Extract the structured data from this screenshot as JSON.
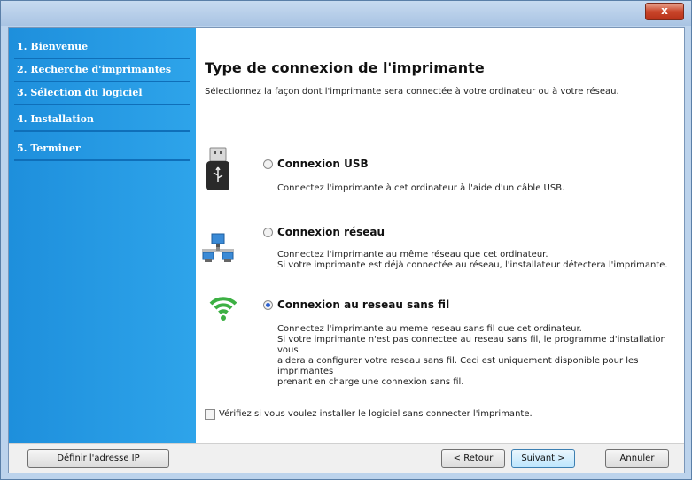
{
  "window": {
    "close_label": "x"
  },
  "sidebar": {
    "items": [
      {
        "label": "1. Bienvenue"
      },
      {
        "label": "2. Recherche d'imprimantes"
      },
      {
        "label": "3. Sélection du logiciel"
      },
      {
        "label": "4. Installation"
      },
      {
        "label": "5. Terminer"
      }
    ]
  },
  "main": {
    "title": "Type de connexion de l'imprimante",
    "subtitle": "Sélectionnez la façon dont l'imprimante sera connectée à votre ordinateur ou à votre réseau.",
    "options": [
      {
        "label": "Connexion USB",
        "checked": false,
        "icon": "usb-drive-icon",
        "desc": [
          "Connectez l'imprimante à cet ordinateur à l'aide d'un câble USB."
        ]
      },
      {
        "label": "Connexion réseau",
        "checked": false,
        "icon": "network-icon",
        "desc": [
          "Connectez l'imprimante au même réseau que cet ordinateur.",
          "Si votre imprimante est déjà connectée au réseau, l'installateur détectera l'imprimante."
        ]
      },
      {
        "label": "Connexion au reseau sans fil",
        "checked": true,
        "icon": "wifi-icon",
        "desc": [
          "Connectez l'imprimante au meme reseau sans fil que cet ordinateur.",
          "Si votre imprimante n'est pas connectee au reseau sans fil, le programme d'installation vous",
          "aidera a configurer votre reseau sans fil. Ceci est uniquement disponible pour les imprimantes",
          "prenant en charge une connexion sans fil."
        ]
      }
    ],
    "checkbox_label": "Vérifiez si vous voulez installer le logiciel sans connecter l'imprimante.",
    "checkbox_checked": false
  },
  "footer": {
    "ip_button": "Définir l'adresse IP",
    "back_button": "< Retour",
    "next_button": "Suivant >",
    "cancel_button": "Annuler"
  },
  "colors": {
    "sidebar": "#2a9be6",
    "titlebar": "#b9d1ec",
    "close": "#c9452a",
    "wifi": "#3cb043"
  }
}
